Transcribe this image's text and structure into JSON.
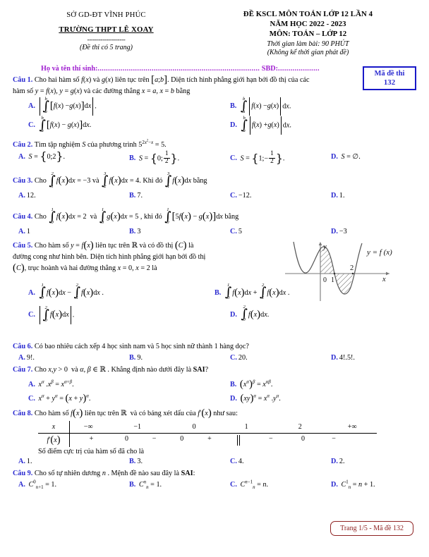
{
  "header": {
    "department": "SỞ GD-ĐT VĨNH PHÚC",
    "school": "TRƯỜNG THPT LÊ XOAY",
    "dashes": "--------------------",
    "pages_note": "(Đề thi có 5 trang)",
    "exam_title": "ĐỀ KSCL MÔN TOÁN LỚP 12 LẦN 4",
    "school_year": "NĂM HỌC 2022 - 2023",
    "subject": "MÔN: TOÁN – LỚP 12",
    "duration": "Thời gian làm bài: 90 PHÚT",
    "duration_note": "(Không kể thời gian phát đề)",
    "code_label": "Mã đề thi",
    "code_value": "132",
    "code_color": "#2a2ad0"
  },
  "info": {
    "name_label": "Họ và tên thí sinh:",
    "name_dots": "..............................................................................",
    "sbd_label": "SBD:",
    "sbd_dots": "....................",
    "color": "#a020d0"
  },
  "questions": [
    {
      "label": "Câu 1.",
      "text_line1": "Cho hai hàm số f(x) và g(x) liên tục trên [a;b]. Diện tích hình phẳng giới hạn bởi đồ thị của các",
      "text_line2": "hàm số y = f(x), y = g(x) và các đường thẳng x = a, x = b bằng",
      "options": [
        {
          "letter": "A.",
          "text": "|∫ₐᵇ [f(x) − g(x)]dx|."
        },
        {
          "letter": "B.",
          "text": "∫ₐᵇ |f(x) − g(x)|dx."
        },
        {
          "letter": "C.",
          "text": "∫ₐᵇ [f(x) − g(x)]dx."
        },
        {
          "letter": "D.",
          "text": "∫ₐᵇ |f(x) + g(x)|dx."
        }
      ]
    },
    {
      "label": "Câu 2.",
      "text_line1": "Tìm tập nghiệm S của phương trình 5^(2x²−x) = 5.",
      "options": [
        {
          "letter": "A.",
          "text": "S = {0;2}."
        },
        {
          "letter": "B.",
          "text": "S = {0; 1/2}."
        },
        {
          "letter": "C.",
          "text": "S = {1; −1/2}."
        },
        {
          "letter": "D.",
          "text": "S = ∅."
        }
      ]
    },
    {
      "label": "Câu 3.",
      "text_line1": "Cho ∫₁² f(x)dx = −3 và ∫₂³ f(x)dx = 4. Khi đó ∫₁³ f(x)dx bằng",
      "options": [
        {
          "letter": "A.",
          "text": "12."
        },
        {
          "letter": "B.",
          "text": "7."
        },
        {
          "letter": "C.",
          "text": "−12."
        },
        {
          "letter": "D.",
          "text": "1."
        }
      ]
    },
    {
      "label": "Câu 4.",
      "text_line1": "Cho ∫₀¹ f(x)dx = 2 và ∫₀¹ g(x)dx = 5, khi đó ∫₀¹ [5f(x) − g(x)]dx bằng",
      "options": [
        {
          "letter": "A.",
          "text": "1"
        },
        {
          "letter": "B.",
          "text": "3"
        },
        {
          "letter": "C.",
          "text": "5"
        },
        {
          "letter": "D.",
          "text": "−3"
        }
      ]
    },
    {
      "label": "Câu 5.",
      "text_line1": "Cho hàm số y = f(x) liên tục trên ℝ và có đồ thị (C) là",
      "text_line2": "đường cong như hình bên. Diện tích hình phẳng giới hạn bởi đồ thị",
      "text_line3": "(C), trục hoành và hai đường thẳng x = 0, x = 2 là",
      "graph": {
        "curve_label": "y = f(x)",
        "x_axis_label": "x",
        "y_axis_label": "y",
        "tick_0": "0",
        "tick_1": "1",
        "tick_2": "2"
      },
      "options": [
        {
          "letter": "A.",
          "text": "∫₀¹ f(x)dx − ∫₁² f(x)dx."
        },
        {
          "letter": "B.",
          "text": "∫₀¹ f(x)dx + ∫₁² f(x)dx."
        },
        {
          "letter": "C.",
          "text": "|∫₀² f(x)dx|."
        },
        {
          "letter": "D.",
          "text": "∫₀² f(x)dx."
        }
      ]
    },
    {
      "label": "Câu 6.",
      "text_line1": "Có bao nhiêu cách xếp 4 học sinh nam và 5 học sinh nữ thành 1 hàng dọc?",
      "options": [
        {
          "letter": "A.",
          "text": "9!."
        },
        {
          "letter": "B.",
          "text": "9."
        },
        {
          "letter": "C.",
          "text": "20."
        },
        {
          "letter": "D.",
          "text": "4!.5!."
        }
      ]
    },
    {
      "label": "Câu 7.",
      "text_line1": "Cho x, y > 0 và α, β ∈ ℝ. Khẳng định nào dưới đây là SAI?",
      "options": [
        {
          "letter": "A.",
          "text": "x^α . x^β = x^(α+β)."
        },
        {
          "letter": "B.",
          "text": "(x^α)^β = x^(αβ)."
        },
        {
          "letter": "C.",
          "text": "x^α + y^α = (x + y)^α."
        },
        {
          "letter": "D.",
          "text": "(xy)^α = x^α . y^α."
        }
      ]
    },
    {
      "label": "Câu 8.",
      "text_line1": "Cho hàm số f(x) liên tục trên ℝ và có bảng xét dấu của f'(x) như sau:",
      "sign_table": {
        "row1_head": "x",
        "row2_head": "f'(x)",
        "x_values": [
          "−∞",
          "−1",
          "0",
          "1",
          "2",
          "+∞"
        ],
        "sign_values": [
          "+",
          "0",
          "−",
          "0",
          "+",
          "||",
          "−",
          "0",
          "−"
        ]
      },
      "sub_text": "Số điểm cực trị của hàm số đã cho là",
      "options": [
        {
          "letter": "A.",
          "text": "1."
        },
        {
          "letter": "B.",
          "text": "3."
        },
        {
          "letter": "C.",
          "text": "4."
        },
        {
          "letter": "D.",
          "text": "2."
        }
      ]
    },
    {
      "label": "Câu 9.",
      "text_line1": "Cho số tự nhiên dương n. Mệnh đề nào sau đây là SAI:",
      "options": [
        {
          "letter": "A.",
          "text": "C⁰ₙ₊₁ = 1."
        },
        {
          "letter": "B.",
          "text": "Cⁿₙ = 1."
        },
        {
          "letter": "C.",
          "text": "Cⁿ⁻¹ₙ = n."
        },
        {
          "letter": "D.",
          "text": "C¹ₙ = n + 1."
        }
      ]
    }
  ],
  "footer": {
    "text": "Trang 1/5 - Mã đề 132",
    "color": "#8f2323"
  }
}
